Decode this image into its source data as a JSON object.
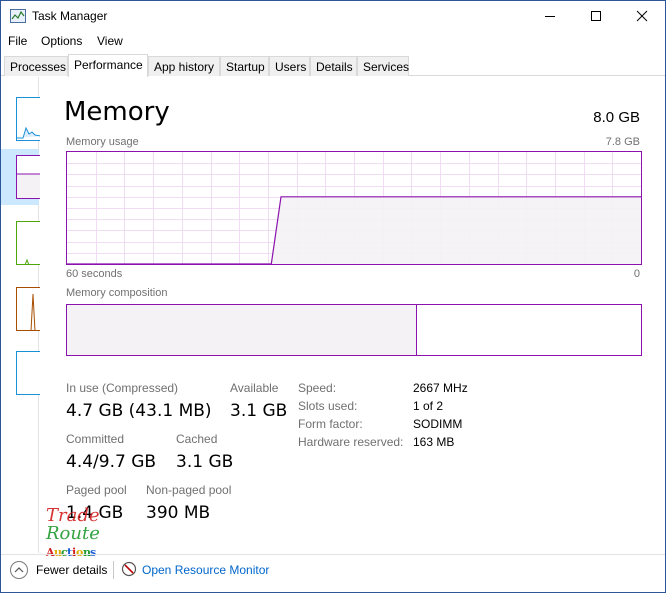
{
  "window": {
    "title": "Task Manager",
    "controls": {
      "minimize": "—",
      "maximize": "☐",
      "close": "✕"
    }
  },
  "menu": {
    "file": "File",
    "options": "Options",
    "view": "View"
  },
  "tabs": [
    {
      "label": "Processes"
    },
    {
      "label": "Performance"
    },
    {
      "label": "App history"
    },
    {
      "label": "Startup"
    },
    {
      "label": "Users"
    },
    {
      "label": "Details"
    },
    {
      "label": "Services"
    }
  ],
  "active_tab": "Performance",
  "sidebar": {
    "items": [
      {
        "name": "cpu",
        "color": "#1a90d9"
      },
      {
        "name": "memory",
        "color": "#8b12ae"
      },
      {
        "name": "disk",
        "color": "#4da60c"
      },
      {
        "name": "ethernet",
        "color": "#a74f01"
      },
      {
        "name": "gpu",
        "color": "#1a90d9"
      }
    ]
  },
  "memory": {
    "title": "Memory",
    "total": "8.0 GB",
    "usage_label": "Memory usage",
    "usage_max": "7.8 GB",
    "time_left": "60 seconds",
    "time_right": "0",
    "composition_label": "Memory composition",
    "composition_in_use_fraction": 0.61,
    "accent_color": "#8b12ae",
    "usage_series_fraction": [
      0,
      0,
      0,
      0,
      0,
      0,
      0,
      0,
      0,
      0,
      0,
      0,
      0,
      0,
      0,
      0,
      0,
      0,
      0,
      0,
      0,
      0,
      0.6,
      0.6,
      0.6,
      0.6,
      0.6,
      0.6,
      0.6,
      0.6,
      0.6,
      0.6,
      0.6,
      0.6,
      0.6,
      0.6,
      0.6,
      0.6,
      0.6,
      0.6,
      0.6,
      0.6,
      0.6,
      0.6,
      0.6,
      0.6,
      0.6,
      0.6,
      0.6,
      0.6,
      0.6,
      0.6,
      0.6,
      0.6,
      0.6,
      0.6,
      0.6,
      0.6,
      0.6,
      0.6
    ],
    "stats": {
      "in_use_label": "In use (Compressed)",
      "in_use_value": "4.7 GB (43.1 MB)",
      "available_label": "Available",
      "available_value": "3.1 GB",
      "committed_label": "Committed",
      "committed_value": "4.4/9.7 GB",
      "cached_label": "Cached",
      "cached_value": "3.1 GB",
      "paged_label": "Paged pool",
      "paged_value": "1.4 GB",
      "nonpaged_label": "Non-paged pool",
      "nonpaged_value": "390 MB"
    },
    "props": {
      "speed_label": "Speed:",
      "speed_value": "2667 MHz",
      "slots_label": "Slots used:",
      "slots_value": "1 of 2",
      "form_label": "Form factor:",
      "form_value": "SODIMM",
      "reserved_label": "Hardware reserved:",
      "reserved_value": "163 MB"
    }
  },
  "footer": {
    "fewer_details": "Fewer details",
    "open_resource_monitor": "Open Resource Monitor"
  },
  "watermark": {
    "line1": "Trade",
    "line2": "Route",
    "line3": "Auctions"
  }
}
